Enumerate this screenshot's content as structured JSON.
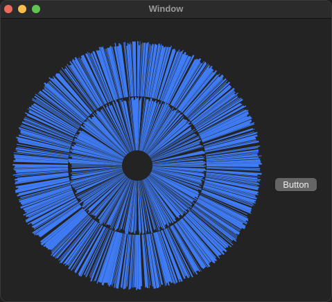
{
  "window": {
    "title": "Window"
  },
  "button": {
    "label": "Button"
  },
  "colors": {
    "accent": "#3f7cf5",
    "background": "#232323",
    "button_bg": "#656565",
    "close": "#ed6a5e",
    "minimize": "#f4bf4f",
    "maximize": "#61c554"
  },
  "icons": {
    "close": "close-icon",
    "minimize": "minimize-icon",
    "maximize": "maximize-icon"
  }
}
